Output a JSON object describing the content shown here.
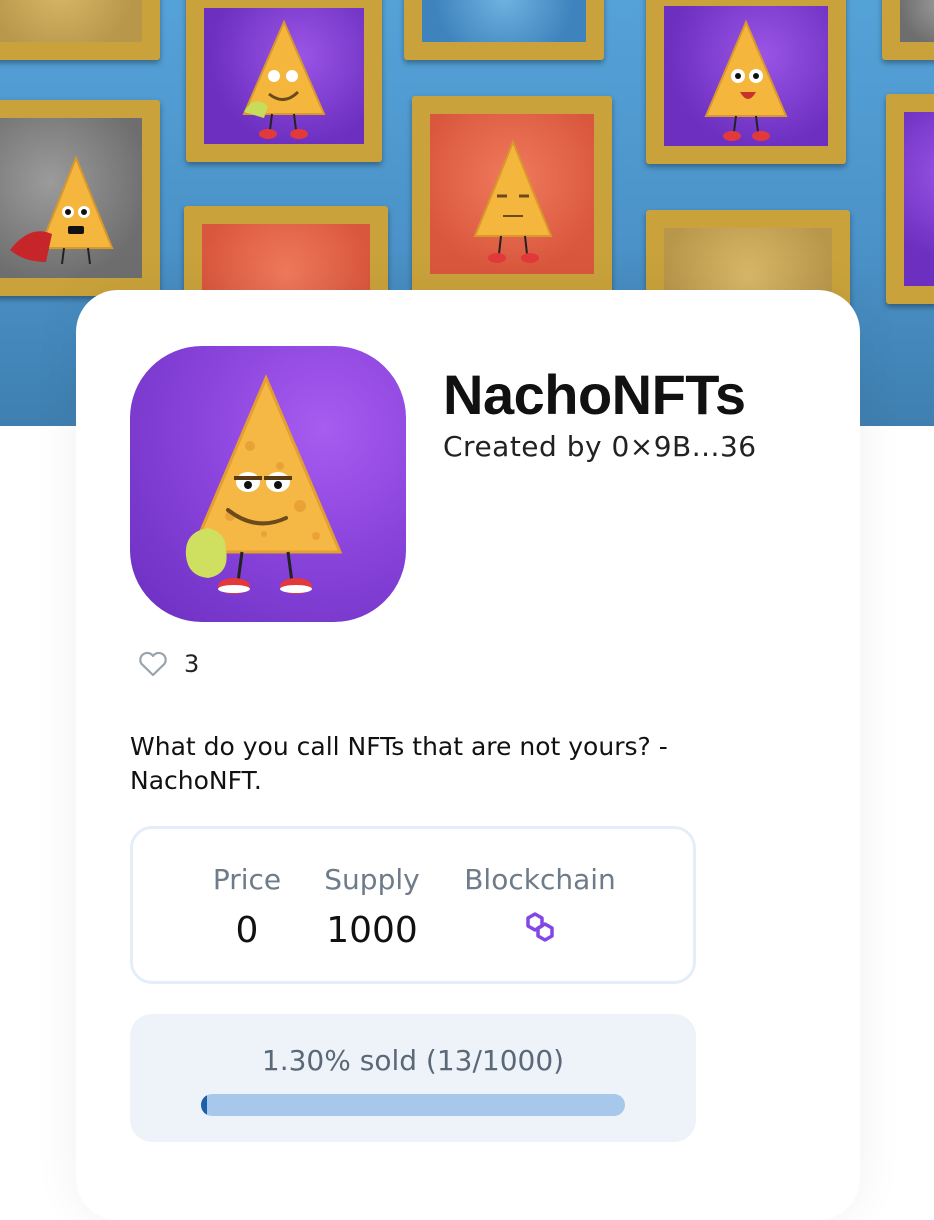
{
  "collection": {
    "title": "NachoNFTs",
    "creator_text": "Created by 0×9B...36",
    "likes": "3",
    "description": "What do you call NFTs that are not yours? - NachoNFT."
  },
  "stats": {
    "price_label": "Price",
    "price_value": "0",
    "supply_label": "Supply",
    "supply_value": "1000",
    "blockchain_label": "Blockchain",
    "blockchain_icon": "polygon-icon"
  },
  "sales": {
    "progress_text": "1.30% sold (13/1000)",
    "sold_fraction": 0.013
  },
  "colors": {
    "polygon": "#8247e5",
    "progress_fill": "#1d5fa8",
    "progress_track": "#a8c8eb"
  }
}
